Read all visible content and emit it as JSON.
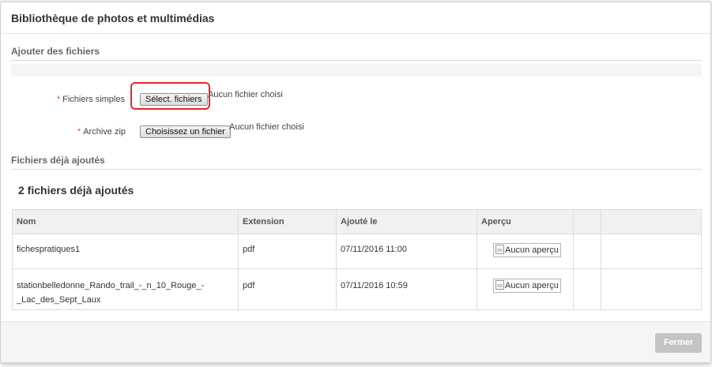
{
  "modal": {
    "title": "Bibliothèque de photos et multimédias"
  },
  "add_section": {
    "title": "Ajouter des fichiers",
    "simple_files": {
      "required_mark": "*",
      "label": "Fichiers simples",
      "button": "Sélect. fichiers",
      "status": "Aucun fichier choisi"
    },
    "zip_archive": {
      "required_mark": "*",
      "label": "Archive zip",
      "button": "Choisissez un fichier",
      "status": "Aucun fichier choisi"
    }
  },
  "existing_section": {
    "title": "Fichiers déjà ajoutés",
    "count_title": "2 fichiers déjà ajoutés",
    "table": {
      "headers": [
        "Nom",
        "Extension",
        "Ajouté le",
        "Aperçu",
        "",
        ""
      ],
      "rows": [
        {
          "name": "fichespratiques1",
          "extension": "pdf",
          "added": "07/11/2016 11:00",
          "preview": "Aucun aperçu"
        },
        {
          "name_line1": "stationbelledonne_Rando_trail_-_n_10_Rouge_-",
          "name_line2": "_Lac_des_Sept_Laux",
          "extension": "pdf",
          "added": "07/11/2016 10:59",
          "preview": "Aucun aperçu"
        }
      ]
    }
  },
  "footer": {
    "close_button": "Fermer"
  },
  "colors": {
    "required": "#d9534f",
    "highlight": "#e0282b",
    "close_button_bg": "#c4c4c4"
  }
}
